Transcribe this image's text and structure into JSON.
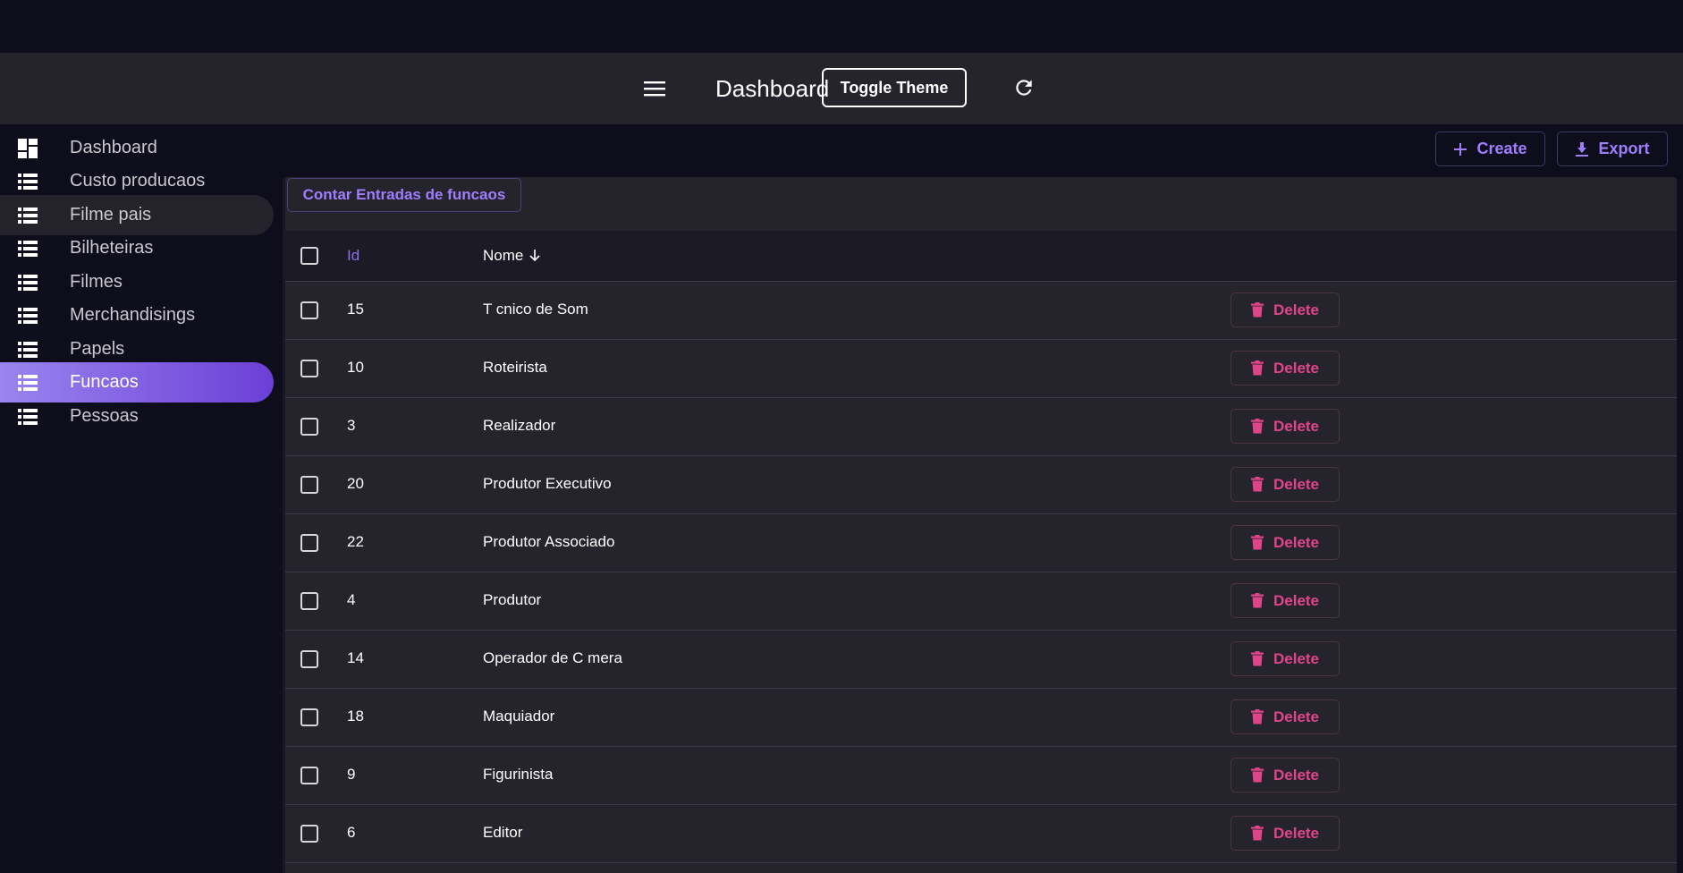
{
  "appbar": {
    "title": "Dashboard",
    "toggle_theme_label": "Toggle Theme",
    "menu_icon": "hamburger-menu-icon",
    "refresh_icon": "refresh-icon"
  },
  "sidebar": {
    "items": [
      {
        "label": "Dashboard",
        "icon": "dashboard-icon"
      },
      {
        "label": "Custo producaos",
        "icon": "list-icon"
      },
      {
        "label": "Filme pais",
        "icon": "list-icon"
      },
      {
        "label": "Bilheteiras",
        "icon": "list-icon"
      },
      {
        "label": "Filmes",
        "icon": "list-icon"
      },
      {
        "label": "Merchandisings",
        "icon": "list-icon"
      },
      {
        "label": "Papels",
        "icon": "list-icon"
      },
      {
        "label": "Funcaos",
        "icon": "list-icon"
      },
      {
        "label": "Pessoas",
        "icon": "list-icon"
      }
    ],
    "active": "Funcaos"
  },
  "toolbar": {
    "create_label": "Create",
    "export_label": "Export"
  },
  "list": {
    "count_button_label": "Contar Entradas de funcaos",
    "columns": {
      "id": "Id",
      "nome": "Nome"
    },
    "sort_icon": "arrow-down-icon",
    "delete_label": "Delete",
    "rows": [
      {
        "id": "15",
        "nome": "T cnico de Som"
      },
      {
        "id": "10",
        "nome": "Roteirista"
      },
      {
        "id": "3",
        "nome": "Realizador"
      },
      {
        "id": "20",
        "nome": "Produtor Executivo"
      },
      {
        "id": "22",
        "nome": "Produtor Associado"
      },
      {
        "id": "4",
        "nome": "Produtor"
      },
      {
        "id": "14",
        "nome": "Operador de C mera"
      },
      {
        "id": "18",
        "nome": "Maquiador"
      },
      {
        "id": "9",
        "nome": "Figurinista"
      },
      {
        "id": "6",
        "nome": "Editor"
      }
    ]
  },
  "colors": {
    "accent": "#a07dfc",
    "danger": "#e0458a",
    "background": "#0e0d1b",
    "surface": "#25242d"
  }
}
